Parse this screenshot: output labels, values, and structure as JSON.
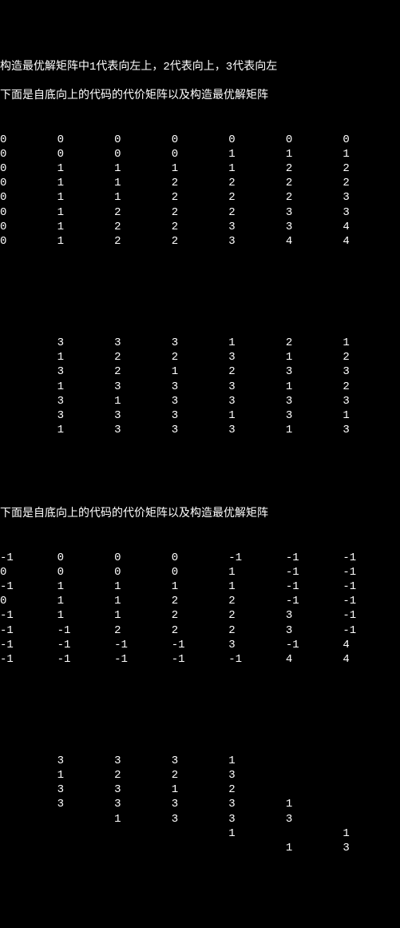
{
  "header1": "构造最优解矩阵中1代表向左上，2代表向上，3代表向左",
  "header2": "下面是自底向上的代码的代价矩阵以及构造最优解矩阵",
  "matrix1": [
    [
      "0",
      "0",
      "0",
      "0",
      "0",
      "0",
      "0"
    ],
    [
      "0",
      "0",
      "0",
      "0",
      "1",
      "1",
      "1"
    ],
    [
      "0",
      "1",
      "1",
      "1",
      "1",
      "2",
      "2"
    ],
    [
      "0",
      "1",
      "1",
      "2",
      "2",
      "2",
      "2"
    ],
    [
      "0",
      "1",
      "1",
      "2",
      "2",
      "2",
      "3"
    ],
    [
      "0",
      "1",
      "2",
      "2",
      "2",
      "3",
      "3"
    ],
    [
      "0",
      "1",
      "2",
      "2",
      "3",
      "3",
      "4"
    ],
    [
      "0",
      "1",
      "2",
      "2",
      "3",
      "4",
      "4"
    ]
  ],
  "matrix2": [
    [
      "3",
      "3",
      "3",
      "1",
      "2",
      "1"
    ],
    [
      "1",
      "2",
      "2",
      "3",
      "1",
      "2"
    ],
    [
      "3",
      "2",
      "1",
      "2",
      "3",
      "3"
    ],
    [
      "1",
      "3",
      "3",
      "3",
      "1",
      "2"
    ],
    [
      "3",
      "1",
      "3",
      "3",
      "3",
      "3"
    ],
    [
      "3",
      "3",
      "3",
      "1",
      "3",
      "1"
    ],
    [
      "1",
      "3",
      "3",
      "3",
      "1",
      "3"
    ]
  ],
  "header3": "下面是自底向上的代码的代价矩阵以及构造最优解矩阵",
  "matrix3": [
    [
      "-1",
      "0",
      "0",
      "0",
      "-1",
      "-1",
      "-1"
    ],
    [
      "0",
      "0",
      "0",
      "0",
      "1",
      "-1",
      "-1"
    ],
    [
      "-1",
      "1",
      "1",
      "1",
      "1",
      "-1",
      "-1"
    ],
    [
      "0",
      "1",
      "1",
      "2",
      "2",
      "-1",
      "-1"
    ],
    [
      "-1",
      "1",
      "1",
      "2",
      "2",
      "3",
      "-1"
    ],
    [
      "-1",
      "-1",
      "2",
      "2",
      "2",
      "3",
      "-1"
    ],
    [
      "-1",
      "-1",
      "-1",
      "-1",
      "3",
      "-1",
      "4"
    ],
    [
      "-1",
      "-1",
      "-1",
      "-1",
      "-1",
      "4",
      "4"
    ]
  ],
  "matrix4": [
    [
      "3",
      "3",
      "3",
      "1",
      "",
      ""
    ],
    [
      "1",
      "2",
      "2",
      "3",
      "",
      ""
    ],
    [
      "3",
      "3",
      "1",
      "2",
      "",
      ""
    ],
    [
      "3",
      "3",
      "3",
      "3",
      "1",
      ""
    ],
    [
      "",
      "1",
      "3",
      "3",
      "3",
      ""
    ],
    [
      "",
      "",
      "",
      "1",
      "",
      "1"
    ],
    [
      "",
      "",
      "",
      "",
      "1",
      "3"
    ]
  ]
}
